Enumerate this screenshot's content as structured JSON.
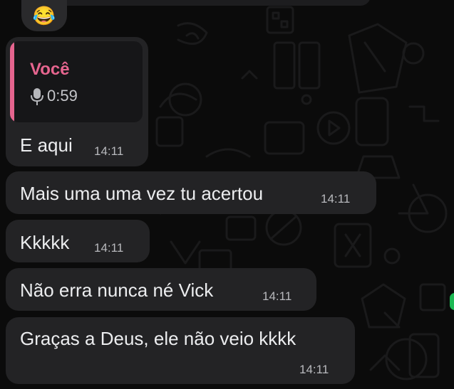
{
  "reaction": {
    "emoji": "😂"
  },
  "quoted": {
    "author": "Você",
    "duration": "0:59",
    "icon": "mic-icon"
  },
  "messages": [
    {
      "text": "E aqui",
      "time": "14:11"
    },
    {
      "text": "Mais uma uma vez tu acertou",
      "time": "14:11"
    },
    {
      "text": "Kkkkk",
      "time": "14:11"
    },
    {
      "text": "Não erra nunca né Vick",
      "time": "14:11"
    },
    {
      "text": "Graças a Deus, ele não veio kkkk",
      "time": "14:11"
    }
  ],
  "colors": {
    "background": "#0b0b0b",
    "bubble": "#232325",
    "quote_accent": "#e6658f",
    "online_indicator": "#1db954"
  }
}
